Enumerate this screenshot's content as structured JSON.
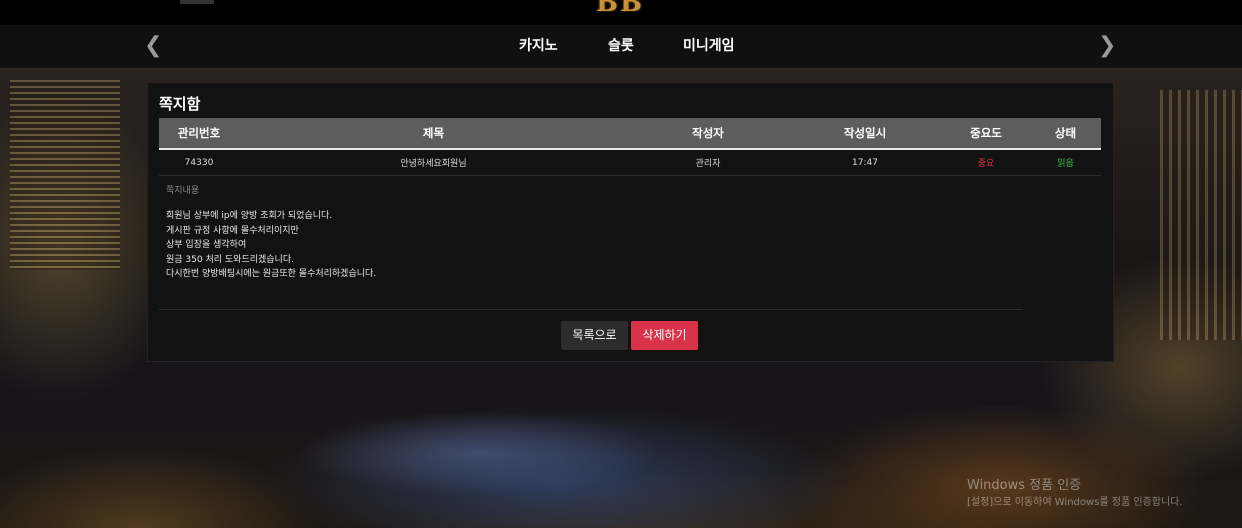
{
  "header": {
    "logo_text": "BB",
    "nav_items": [
      "카지노",
      "슬롯",
      "미니게임"
    ]
  },
  "panel": {
    "title": "쪽지함",
    "columns": [
      "관리번호",
      "제목",
      "작성자",
      "작성일시",
      "중요도",
      "상태"
    ],
    "rows": [
      {
        "id": "74330",
        "subject": "안녕하세요회원님",
        "author": "관리자",
        "datetime": "17:47",
        "importance": "중요",
        "status": "읽음"
      }
    ],
    "message_label": "쪽지내용",
    "message_lines": [
      "회원님 상부에 ip에 양방 조회가 되었습니다.",
      "게시판 규정 사항에 몰수처리이지만",
      "상부 입장을 생각하여",
      "원금 350 처리 도와드리겠습니다.",
      "다시한번 양방배팅시에는 원금또한 몰수처리하겠습니다."
    ],
    "buttons": {
      "list": "목록으로",
      "delete": "삭제하기"
    }
  },
  "watermark": {
    "title": "Windows 정품 인증",
    "subtitle": "[설정]으로 이동하여 Windows를 정품 인증합니다."
  },
  "colors": {
    "importance": "#e0313f",
    "status": "#3ac24a",
    "delete_button": "#d9334a"
  }
}
